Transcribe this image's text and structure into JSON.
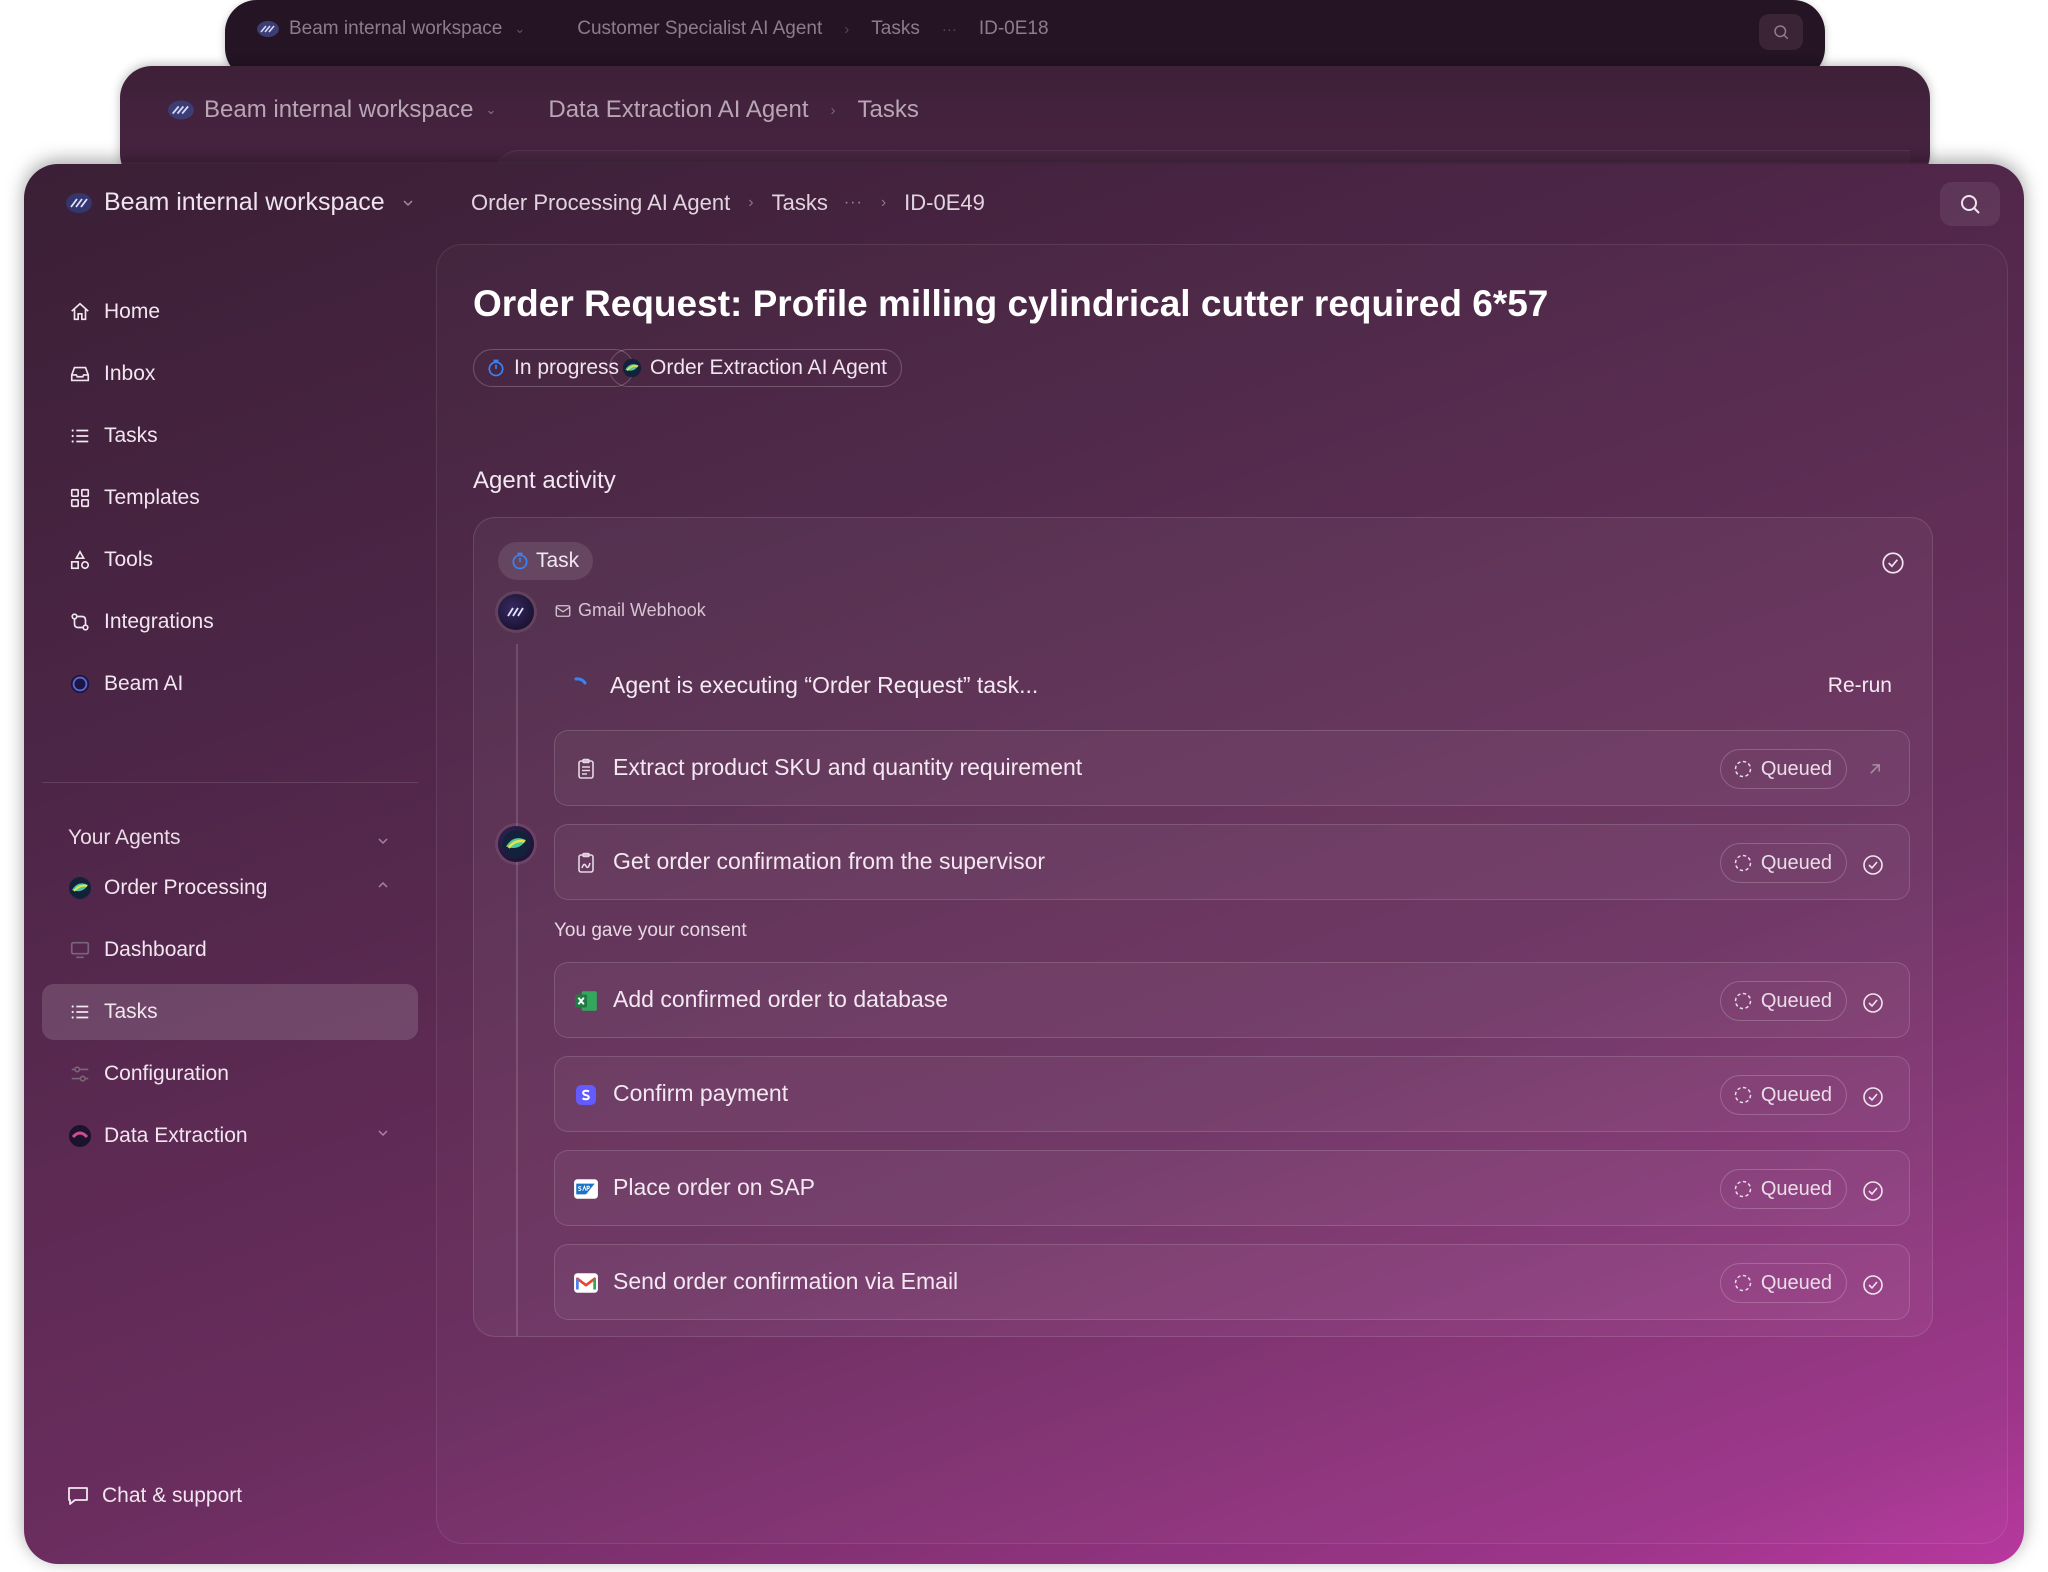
{
  "background_windows": [
    {
      "workspace": "Beam internal workspace",
      "breadcrumb": [
        "Customer Specialist AI Agent",
        "Tasks",
        "···",
        "ID-0E18"
      ]
    },
    {
      "workspace": "Beam internal workspace",
      "breadcrumb": [
        "Data Extraction AI Agent",
        "Tasks"
      ]
    }
  ],
  "header": {
    "workspace": "Beam internal workspace",
    "breadcrumb": {
      "agent": "Order Processing AI Agent",
      "tasks": "Tasks",
      "dots": "···",
      "id": "ID-0E49"
    }
  },
  "sidebar": {
    "items": [
      {
        "label": "Home",
        "icon": "home-icon"
      },
      {
        "label": "Inbox",
        "icon": "inbox-icon"
      },
      {
        "label": "Tasks",
        "icon": "list-icon"
      },
      {
        "label": "Templates",
        "icon": "grid-icon"
      },
      {
        "label": "Tools",
        "icon": "shapes-icon"
      },
      {
        "label": "Integrations",
        "icon": "integrations-icon"
      },
      {
        "label": "Beam AI",
        "icon": "beam-ai-icon"
      }
    ],
    "section_label": "Your Agents",
    "agents": [
      {
        "label": "Order Processing",
        "icon": "order-processing-agent-icon"
      },
      {
        "label": "Dashboard",
        "icon": "monitor-icon"
      },
      {
        "label": "Tasks",
        "icon": "list-icon",
        "active": true
      },
      {
        "label": "Configuration",
        "icon": "sliders-icon"
      },
      {
        "label": "Data Extraction",
        "icon": "data-extraction-agent-icon"
      }
    ],
    "chat_support": "Chat & support"
  },
  "task": {
    "title": "Order Request: Profile milling cylindrical cutter required 6*57",
    "status": "In progress",
    "agent": "Order Extraction AI Agent"
  },
  "activity": {
    "heading": "Agent activity",
    "task_chip": "Task",
    "source": "Gmail Webhook",
    "executing": "Agent  is executing “Order Request” task...",
    "rerun": "Re-run",
    "consent": "You gave your consent",
    "steps": [
      {
        "label": "Extract product SKU and quantity requirement",
        "status": "Queued",
        "icon": "clipboard-icon",
        "trail": "arrow-up-right-icon"
      },
      {
        "label": "Get order confirmation from the supervisor",
        "status": "Queued",
        "icon": "clipboard-sign-icon",
        "trail": "check-circle-icon"
      },
      {
        "label": "Add confirmed order to database",
        "status": "Queued",
        "icon": "excel-icon",
        "trail": "check-circle-icon"
      },
      {
        "label": "Confirm payment",
        "status": "Queued",
        "icon": "stripe-icon",
        "trail": "check-circle-icon"
      },
      {
        "label": "Place order on SAP",
        "status": "Queued",
        "icon": "sap-icon",
        "trail": "check-circle-icon"
      },
      {
        "label": "Send order confirmation via Email",
        "status": "Queued",
        "icon": "gmail-icon",
        "trail": "check-circle-icon"
      }
    ]
  },
  "colors": {
    "accent_blue": "#3b82f6",
    "excel_green": "#1f8f4e",
    "stripe_purple": "#635bff",
    "sap_blue": "#1a73c9",
    "gmail_red": "#ea4335"
  }
}
